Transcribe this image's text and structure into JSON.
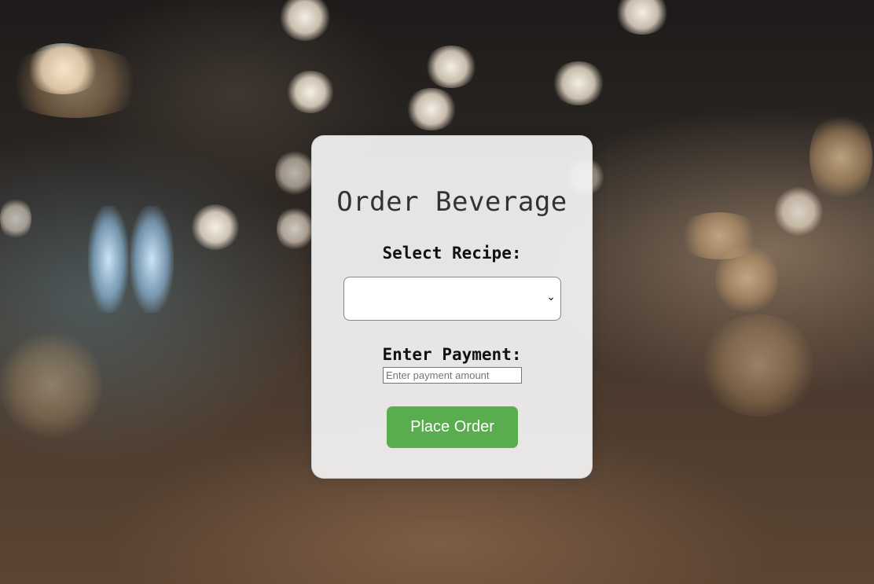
{
  "page": {
    "title": "Order Beverage"
  },
  "recipe": {
    "label": "Select Recipe:",
    "selected": ""
  },
  "payment": {
    "label": "Enter Payment:",
    "placeholder": "Enter payment amount",
    "value": ""
  },
  "order_button": {
    "label": "Place Order"
  },
  "colors": {
    "button_bg": "#5aad4f",
    "panel_bg": "#f5f5f5",
    "title_text": "#333333"
  },
  "icons": {
    "select_arrow": "chevron-down-icon"
  }
}
